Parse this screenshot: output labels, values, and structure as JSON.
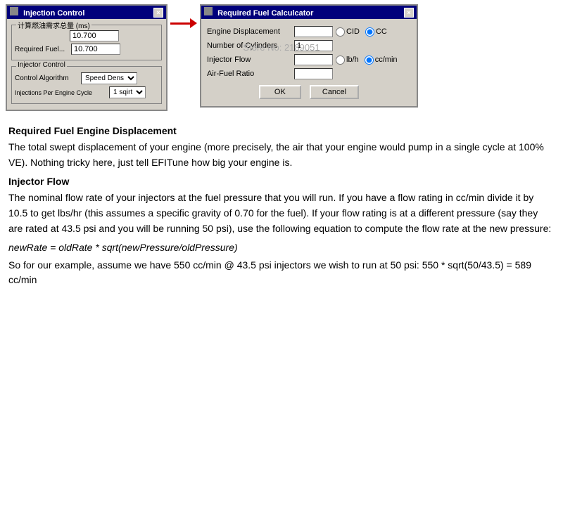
{
  "dialogs": {
    "injection": {
      "title": "Injection Control",
      "group_title": "计算燃油需求总量 (ms)",
      "field1_label": "",
      "field1_value": "10.700",
      "field2_label": "Required Fuel...",
      "field2_value": "10.700",
      "injector_group_title": "Injector Control",
      "control_algorithm_label": "Control Algorithm",
      "control_algorithm_value": "Speed Dens",
      "injections_label": "Injections Per Engine Cycle",
      "injections_value": "1 sqirt",
      "close_label": "×"
    },
    "fuel": {
      "title": "Required Fuel Calculcator",
      "fields": [
        {
          "label": "Engine Displacement",
          "input": true,
          "radios": [
            "CID",
            "CC"
          ],
          "selected": "CC"
        },
        {
          "label": "Number of Cylinders",
          "input": true,
          "input_value": "1",
          "radios": [],
          "selected": null
        },
        {
          "label": "Injector Flow",
          "input": true,
          "radios": [
            "lb/h",
            "cc/min"
          ],
          "selected": "cc/min"
        },
        {
          "label": "Air-Fuel Ratio",
          "input": true,
          "radios": [],
          "selected": null
        }
      ],
      "ok_label": "OK",
      "cancel_label": "Cancel",
      "close_label": "×"
    }
  },
  "store_watermark": "Store No: 2189051",
  "content": {
    "section1_heading": "Required Fuel Engine Displacement",
    "section1_text": "The total swept displacement of your engine (more precisely, the air that your engine would pump in a single cycle at 100% VE). Nothing tricky here, just tell EFITune how big your engine is.",
    "section2_heading": "Injector Flow",
    "section2_text": "The nominal flow rate of your injectors at the fuel pressure that you will run. If you have a flow rating in cc/min divide it by 10.5 to get lbs/hr (this assumes a specific gravity of 0.70 for the fuel). If your flow rating is at a different pressure (say they are rated at 43.5 psi and you will be running 50 psi), use the following equation to compute the flow rate at the new pressure:",
    "formula": "newRate = oldRate * sqrt(newPressure/oldPressure)",
    "calc_text": "So for our example, assume we have 550 cc/min @ 43.5 psi injectors we wish to run at 50 psi: 550 * sqrt(50/43.5) = 589 cc/min"
  }
}
